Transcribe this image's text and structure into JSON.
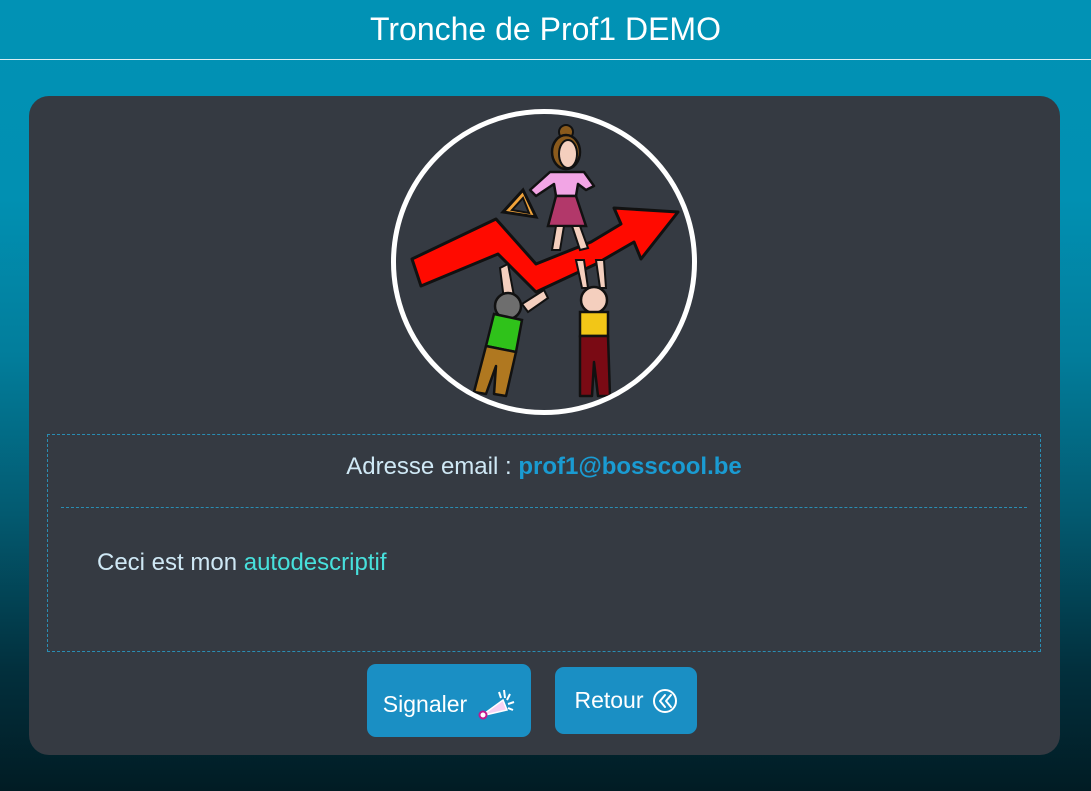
{
  "header": {
    "title": "Tronche de Prof1 DEMO"
  },
  "profile": {
    "avatar_icon": "teamwork-rising-arrow-avatar",
    "email_label": "Adresse email :",
    "email_value": "prof1@bosscool.be",
    "description_prefix": "Ceci est mon",
    "description_highlight": "autodescriptif"
  },
  "actions": {
    "report_label": "Signaler",
    "report_icon": "party-popper-icon",
    "back_label": "Retour",
    "back_icon": "double-chevron-left-circle-icon"
  },
  "colors": {
    "accent": "#1a8fc4",
    "email": "#1a9bd2",
    "highlight": "#47e0dc",
    "card": "#353a42"
  }
}
